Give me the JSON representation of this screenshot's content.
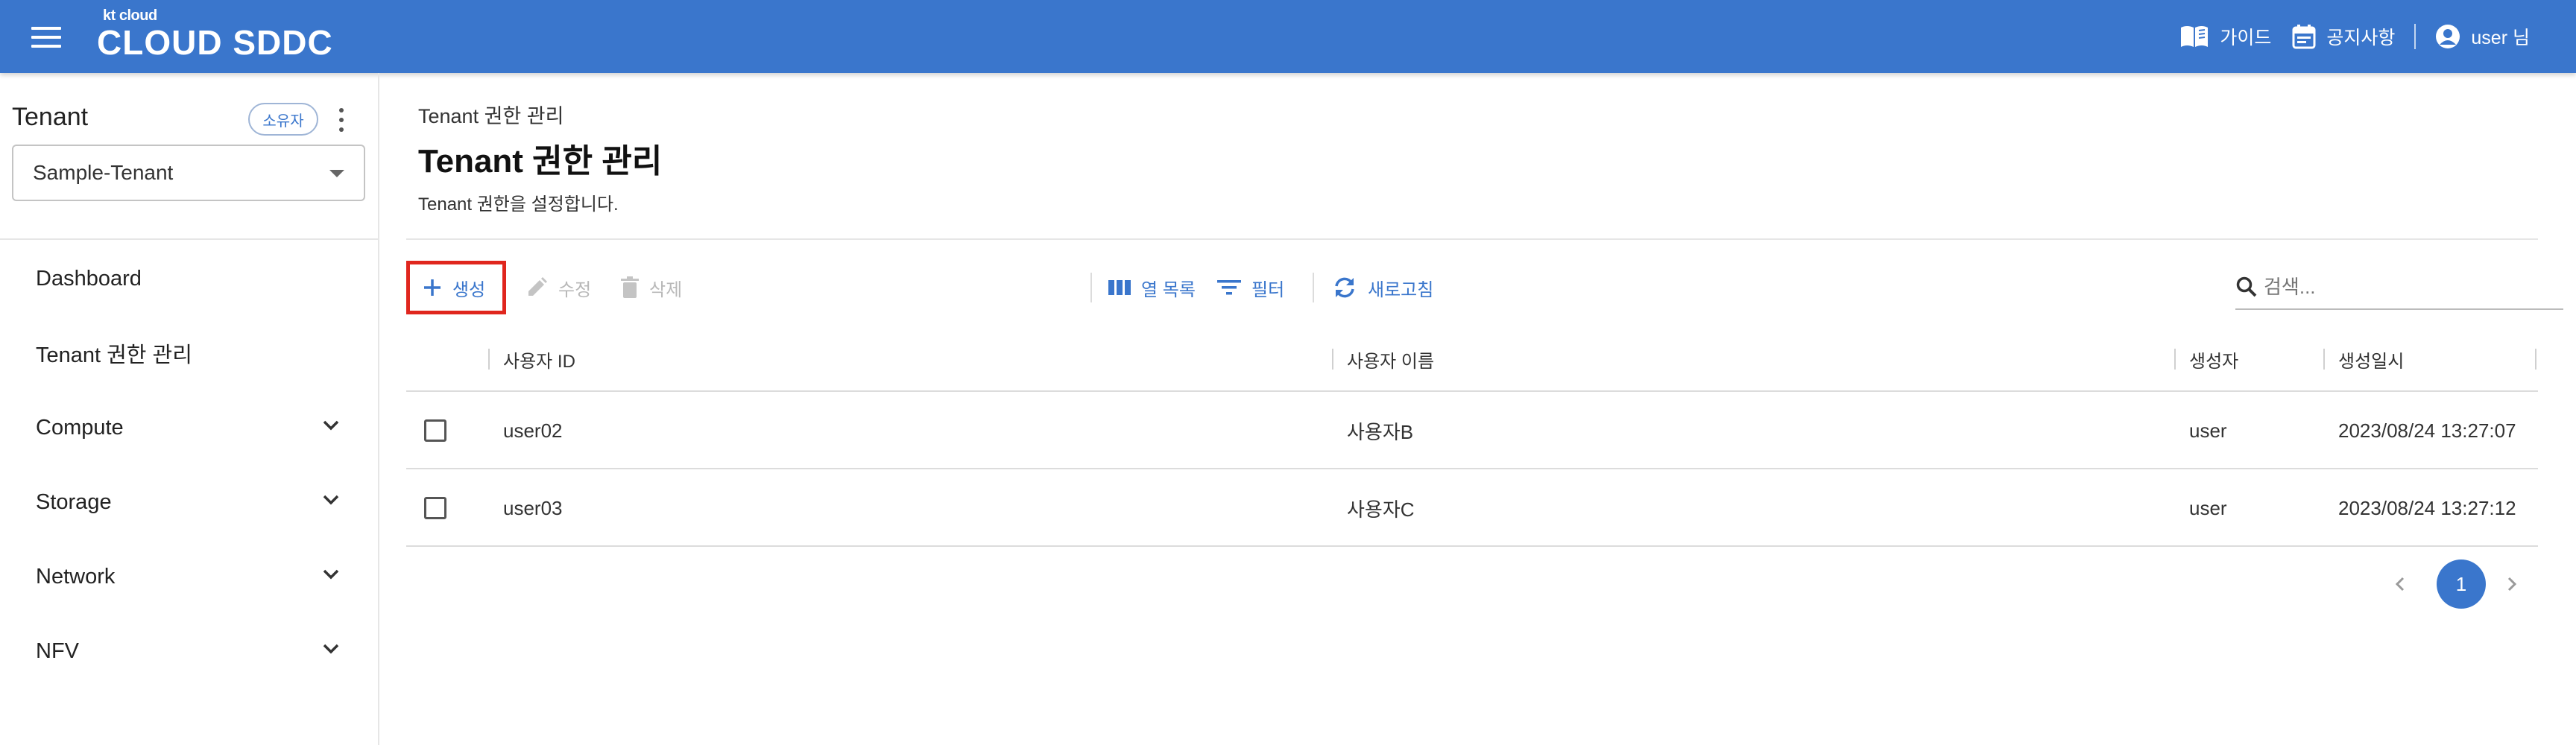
{
  "header": {
    "logo_small": "kt cloud",
    "logo_main": "CLOUD SDDC",
    "guide_label": "가이드",
    "notice_label": "공지사항",
    "user_label": "user 님"
  },
  "sidebar": {
    "title": "Tenant",
    "owner_badge": "소유자",
    "selected_tenant": "Sample-Tenant",
    "items": [
      {
        "label": "Dashboard"
      },
      {
        "label": "Tenant 권한 관리"
      },
      {
        "label": "Compute"
      },
      {
        "label": "Storage"
      },
      {
        "label": "Network"
      },
      {
        "label": "NFV"
      }
    ]
  },
  "page": {
    "breadcrumb": "Tenant 권한 관리",
    "title": "Tenant 권한 관리",
    "description": "Tenant 권한을 설정합니다."
  },
  "toolbar": {
    "create_label": "생성",
    "edit_label": "수정",
    "delete_label": "삭제",
    "columns_label": "열 목록",
    "filter_label": "필터",
    "refresh_label": "새로고침",
    "search_placeholder": "검색..."
  },
  "table": {
    "headers": [
      "사용자 ID",
      "사용자 이름",
      "생성자",
      "생성일시"
    ],
    "rows": [
      [
        "user02",
        "사용자B",
        "user",
        "2023/08/24 13:27:07"
      ],
      [
        "user03",
        "사용자C",
        "user",
        "2023/08/24 13:27:12"
      ]
    ]
  },
  "pagination": {
    "current_page": "1"
  },
  "colors": {
    "primary": "#3a76cc",
    "highlight": "#e0261e"
  }
}
